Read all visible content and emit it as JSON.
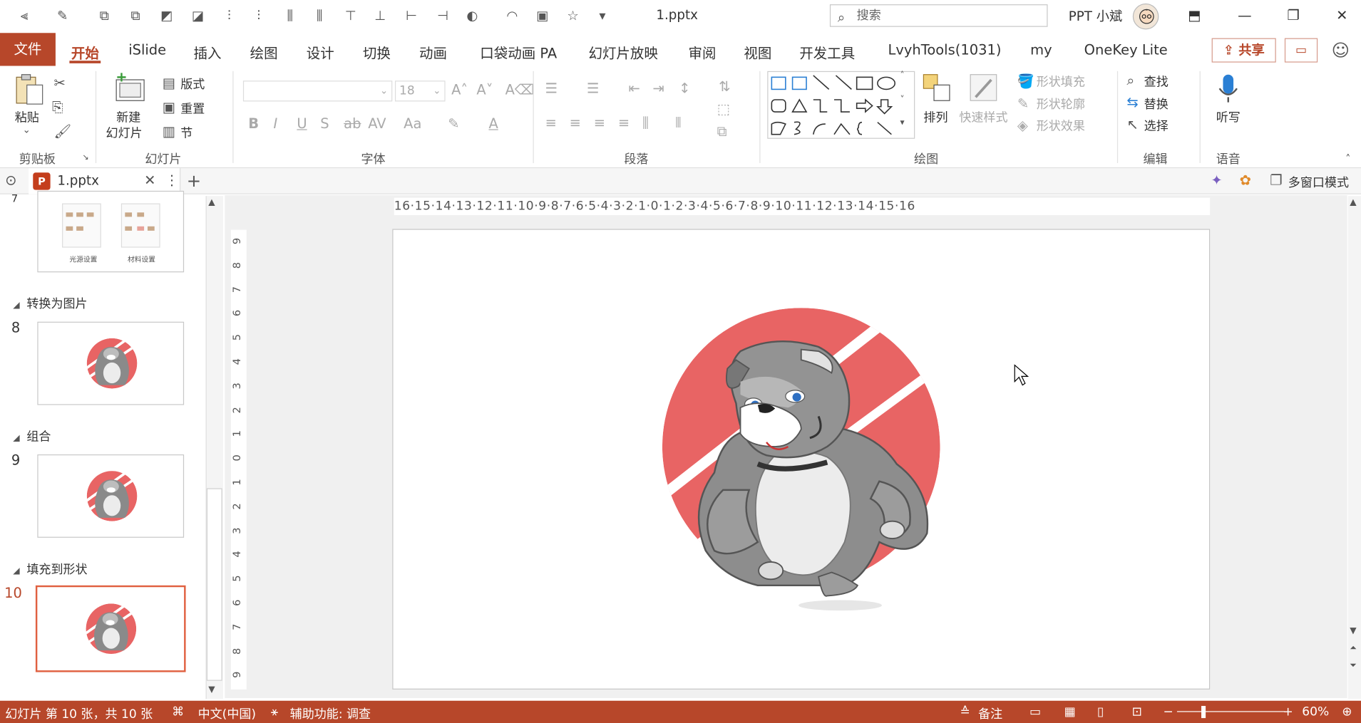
{
  "title_bar": {
    "document_title": "1.pptx",
    "search_placeholder": "搜索",
    "user_name": "PPT 小斌",
    "window_controls": [
      "ribbon-display-icon",
      "minimize-icon",
      "restore-icon",
      "close-icon"
    ]
  },
  "menu": {
    "file": "文件",
    "tabs": [
      "开始",
      "iSlide",
      "插入",
      "绘图",
      "设计",
      "切换",
      "动画",
      "口袋动画 PA",
      "幻灯片放映",
      "审阅",
      "视图",
      "开发工具",
      "LvyhTools(1031)",
      "my",
      "OneKey Lite"
    ],
    "active_tab": "开始",
    "share": "共享"
  },
  "ribbon": {
    "clipboard": {
      "paste": "粘贴",
      "group": "剪贴板"
    },
    "slides": {
      "new_slide_l1": "新建",
      "new_slide_l2": "幻灯片",
      "layout": "版式",
      "reset": "重置",
      "section": "节",
      "group": "幻灯片"
    },
    "font": {
      "size": "18",
      "group": "字体"
    },
    "paragraph": {
      "group": "段落"
    },
    "drawing": {
      "arrange": "排列",
      "quick_styles": "快速样式",
      "shape_fill": "形状填充",
      "shape_outline": "形状轮廓",
      "shape_effects": "形状效果",
      "group": "绘图"
    },
    "editing": {
      "find": "查找",
      "replace": "替换",
      "select": "选择",
      "group": "编辑"
    },
    "voice": {
      "dictate": "听写",
      "group": "语音"
    }
  },
  "doc_tabs": {
    "active": "1.pptx",
    "multi_window": "多窗口模式"
  },
  "thumbnails": {
    "top_partial_num": "7",
    "partial_labels": [
      "光源设置",
      "材料设置"
    ],
    "items": [
      {
        "section": "转换为图片",
        "num": "8"
      },
      {
        "section": "组合",
        "num": "9"
      },
      {
        "section": "填充到形状",
        "num": "10",
        "selected": true
      }
    ]
  },
  "ruler": {
    "horizontal": "16·15·14·13·12·11·10·9·8·7·6·5·4·3·2·1·0·1·2·3·4·5·6·7·8·9·10·11·12·13·14·15·16",
    "vertical": [
      "9",
      "8",
      "7",
      "6",
      "5",
      "4",
      "3",
      "2",
      "1",
      "0",
      "1",
      "2",
      "3",
      "4",
      "5",
      "6",
      "7",
      "8",
      "9"
    ]
  },
  "status": {
    "slide_info": "幻灯片 第 10 张，共 10 张",
    "language": "中文(中国)",
    "accessibility": "辅助功能: 调查",
    "notes": "备注",
    "zoom": "60%"
  },
  "colors": {
    "accent": "#b7472a",
    "circle": "#e86464",
    "dog_gray": "#8a8a8a"
  }
}
